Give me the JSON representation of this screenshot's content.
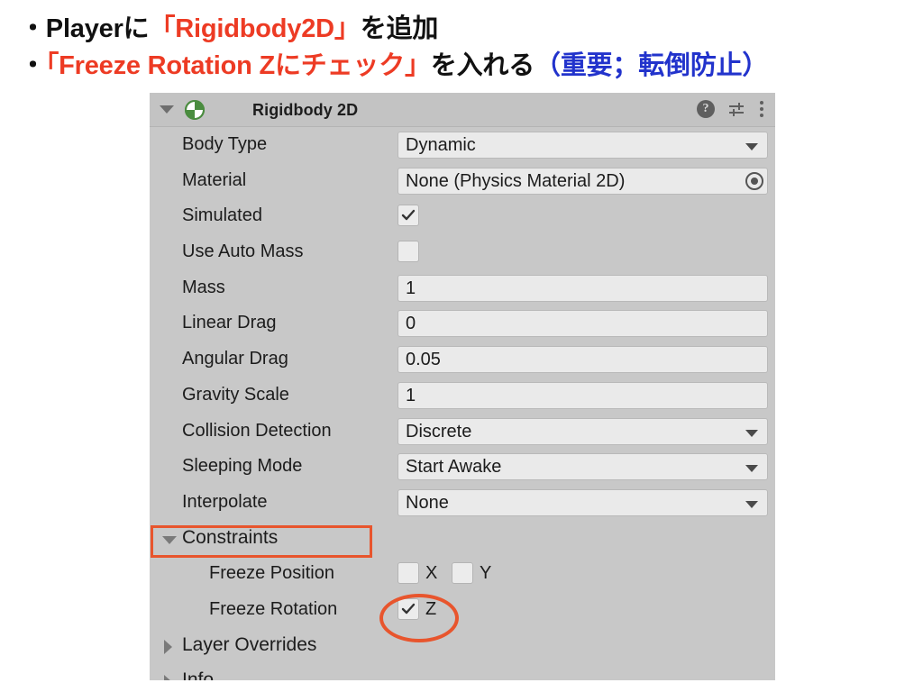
{
  "slide": {
    "lines": [
      {
        "segments": [
          {
            "text": "・Player",
            "color": "black"
          },
          {
            "text": "に",
            "color": "black"
          },
          {
            "text": "「Rigidbody2D」",
            "color": "red"
          },
          {
            "text": "を追加",
            "color": "black"
          }
        ]
      },
      {
        "segments": [
          {
            "text": "・",
            "color": "black"
          },
          {
            "text": "「Freeze Rotation Zにチェック」",
            "color": "red"
          },
          {
            "text": "を入れる",
            "color": "black"
          },
          {
            "text": "（重要；転倒防止）",
            "color": "blue"
          }
        ]
      }
    ],
    "colors": {
      "red": "#ED3B24",
      "blue": "#2233CC",
      "black": "#111111"
    }
  },
  "inspector": {
    "component": {
      "title": "Rigidbody 2D",
      "foldout_state": "expanded",
      "icon_name": "rigidbody2d-icon",
      "icon_color": "#4a8c3f",
      "header_actions": [
        {
          "name": "help-icon",
          "glyph": "?"
        },
        {
          "name": "preset-icon",
          "glyph": "sliders"
        },
        {
          "name": "kebab-menu-icon",
          "glyph": "⋮"
        }
      ]
    },
    "rows": [
      {
        "label": "Body Type",
        "type": "dropdown",
        "value": "Dynamic"
      },
      {
        "label": "Material",
        "type": "object",
        "value": "None (Physics Material 2D)"
      },
      {
        "label": "Simulated",
        "type": "checkbox",
        "checked": true
      },
      {
        "label": "Use Auto Mass",
        "type": "checkbox",
        "checked": false
      },
      {
        "label": "Mass",
        "type": "text",
        "value": "1"
      },
      {
        "label": "Linear Drag",
        "type": "text",
        "value": "0"
      },
      {
        "label": "Angular Drag",
        "type": "text",
        "value": "0.05"
      },
      {
        "label": "Gravity Scale",
        "type": "text",
        "value": "1"
      },
      {
        "label": "Collision Detection",
        "type": "dropdown",
        "value": "Discrete"
      },
      {
        "label": "Sleeping Mode",
        "type": "dropdown",
        "value": "Start Awake"
      },
      {
        "label": "Interpolate",
        "type": "dropdown",
        "value": "None"
      }
    ],
    "constraints": {
      "label": "Constraints",
      "foldout_state": "expanded",
      "freeze_position": {
        "label": "Freeze Position",
        "axes": [
          {
            "axis": "X",
            "checked": false
          },
          {
            "axis": "Y",
            "checked": false
          }
        ]
      },
      "freeze_rotation": {
        "label": "Freeze Rotation",
        "axes": [
          {
            "axis": "Z",
            "checked": true
          }
        ]
      }
    },
    "layer_overrides": {
      "label": "Layer Overrides",
      "foldout_state": "collapsed"
    },
    "info": {
      "label": "Info",
      "foldout_state": "collapsed"
    }
  },
  "annotations": {
    "color": "#E8552D",
    "rect_target": "Constraints",
    "ellipse_target": "Freeze Rotation Z"
  }
}
